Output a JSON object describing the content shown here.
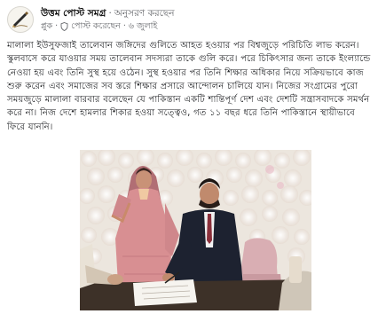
{
  "post": {
    "page_name": "উত্তম পোস্ট সমগ্র",
    "separator": "·",
    "follow_label": "অনুসরণ করছেন",
    "by_label": "প্লুক",
    "posted_label": "পোস্ট করেছেন",
    "date": "৬ জুলাই",
    "body": "মালালা ইউসুফজাই তালেবান জঙ্গিদের গুলিতে আহত হওয়ার পর বিশ্বজুড়ে পরিচিতি লাভ করেন। স্কুলবাসে করে যাওয়ার সময় তালেবান সদস্যরা তাকে গুলি করে। পরে চিকিৎসার জন্য তাকে ইংল্যান্ডে নেওয়া হয় এবং তিনি সুস্থ হয়ে ওঠেন। সুস্থ হওয়ার পর তিনি শিক্ষার অধিকার নিয়ে সক্রিয়ভাবে কাজ শুরু করেন এবং সমাজের সব স্তরে শিক্ষার প্রসারে আন্দোলন চালিয়ে যান। নিজের সংগ্রামের পুরো সময়জুড়ে মালালা বারবার বলেছেন যে পাকিস্তান একটি শান্তিপূর্ণ দেশ এবং দেশটি সন্ত্রাসবাদকে সমর্থন করে না। নিজ দেশে হামলার শিকার হওয়া সত্ত্বেও, গত ১১ বছর ধরে তিনি পাকিস্তানে স্থায়ীভাবে ফিরে যাননি।"
  },
  "icons": {
    "avatar": "pen-logo-icon",
    "audience": "shield-icon"
  },
  "colors": {
    "text": "#1c1e21",
    "meta": "#65676b",
    "photo_background": "#e9e4da"
  }
}
